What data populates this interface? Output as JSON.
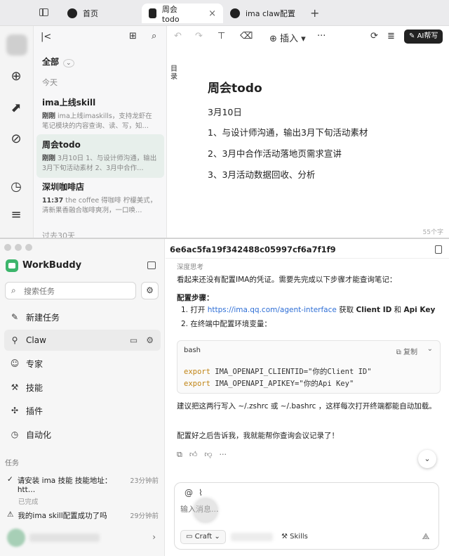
{
  "top": {
    "tabs": [
      {
        "label": "首页"
      },
      {
        "label": "周会todo",
        "close": "×"
      },
      {
        "label": "ima claw配置"
      }
    ],
    "tab_add": "+",
    "list": {
      "filter": "全部",
      "groups": [
        "今天",
        "过去30天"
      ],
      "notes": [
        {
          "title": "ima上线skill",
          "time": "刚刚",
          "snippet": "ima上线imaskills，支持龙虾在笔记模块的内容查询、读、写，知…"
        },
        {
          "title": "周会todo",
          "time": "刚刚",
          "snippet": "3月10日 1、与设计师沟通，输出3月下旬活动素材 2、3月中合作…"
        },
        {
          "title": "深圳咖啡店",
          "time": "11:37",
          "snippet": "the coffee 得咖啡 柠檬美式，清新果香融合咖啡爽冽，一口唤…"
        }
      ]
    },
    "editor": {
      "toolbar": {
        "insert": "插入",
        "more": "···",
        "ai": "AI帮写"
      },
      "toc": "目录",
      "title": "周会todo",
      "lines": [
        "3月10日",
        "1、与设计师沟通，输出3月下旬活动素材",
        "2、3月中合作活动落地页需求宣讲",
        "3、3月活动数据回收、分析"
      ],
      "word_count": "55个字"
    }
  },
  "bottom": {
    "app_name": "WorkBuddy",
    "search_placeholder": "搜索任务",
    "nav": [
      {
        "label": "新建任务",
        "icon": "✎"
      },
      {
        "label": "Claw",
        "icon": "⚲"
      },
      {
        "label": "专家",
        "icon": "☺"
      },
      {
        "label": "技能",
        "icon": "⚒"
      },
      {
        "label": "插件",
        "icon": "✣"
      },
      {
        "label": "自动化",
        "icon": "◷"
      }
    ],
    "tasks_label": "任务",
    "tasks": [
      {
        "title": "请安装 ima 技能 技能地址：htt…",
        "time": "23分钟前",
        "status": "已完成"
      },
      {
        "title": "我的ima skill配置成功了吗",
        "time": "29分钟前"
      }
    ],
    "conversation": {
      "id": "6e6ac5fa19f342488c05997cf6a7f1f9",
      "thinking": "深度思考",
      "intro": "看起来还没有配置IMA的凭证。需要先完成以下步骤才能查询笔记：",
      "steps_title": "配置步骤：",
      "step1_prefix": "1. 打开 ",
      "step1_link": "https://ima.qq.com/agent-interface",
      "step1_mid": " 获取 ",
      "step1_b1": "Client ID",
      "step1_and": " 和 ",
      "step1_b2": "Api Key",
      "step2": "2. 在终端中配置环境变量：",
      "code": {
        "lang": "bash",
        "copy": "复制",
        "lines": [
          {
            "kw": "export",
            "rest": " IMA_OPENAPI_CLIENTID=\"你的Client ID\""
          },
          {
            "kw": "export",
            "rest": " IMA_OPENAPI_APIKEY=\"你的Api Key\""
          }
        ]
      },
      "suggest": "建议把这两行写入 ~/.zshrc 或 ~/.bashrc ，这样每次打开终端都能自动加载。",
      "closing": "配置好之后告诉我，我就能帮你查询会议记录了！"
    },
    "composer": {
      "placeholder": "输入消息...",
      "mode": "Craft",
      "skills": "Skills"
    }
  }
}
